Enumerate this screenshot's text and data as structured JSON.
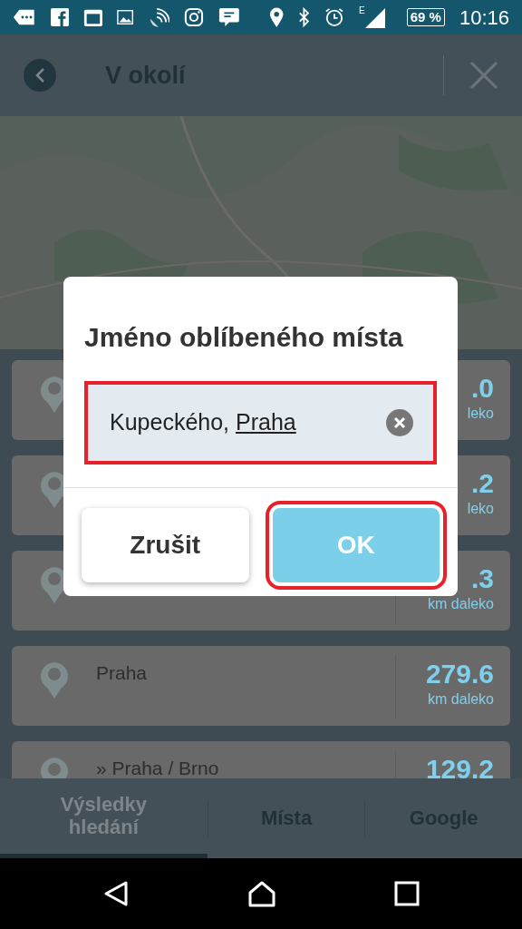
{
  "status_bar": {
    "network": "E",
    "battery": "69 %",
    "time": "10:16"
  },
  "header": {
    "title": "V okolí"
  },
  "results": [
    {
      "distance": ".0",
      "unit": "leko"
    },
    {
      "distance": ".2",
      "unit": "leko"
    },
    {
      "distance": ".3",
      "unit": "km daleko"
    },
    {
      "title": "Praha",
      "distance": "279.6",
      "unit": "km daleko"
    },
    {
      "title": "» Praha / Brno",
      "distance": "129.2"
    }
  ],
  "tabs": [
    {
      "label": "Výsledky hledání",
      "selected": true
    },
    {
      "label": "Místa",
      "selected": false
    },
    {
      "label": "Google",
      "selected": false
    }
  ],
  "dialog": {
    "title": "Jméno oblíbeného místa",
    "field": {
      "text": "Kupeckého,",
      "composing": "Praha",
      "highlighted": true
    },
    "buttons": [
      {
        "label": "Zrušit",
        "kind": "secondary",
        "highlighted": false
      },
      {
        "label": "OK",
        "kind": "primary",
        "highlighted": true
      }
    ]
  }
}
